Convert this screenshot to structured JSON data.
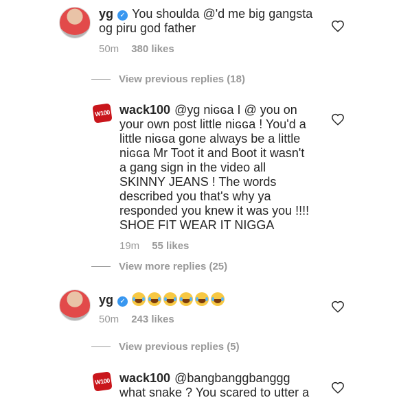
{
  "comments": [
    {
      "username": "yg",
      "text": "You shoulda @'d me big gangsta og piru god father",
      "time": "50m",
      "likes": "380 likes"
    },
    {
      "username": "wack100",
      "text": "@yg niɢɢa I @ you on your own post little niɢɢa ! You'd a little niɢɢa gone always be a little niɢɢa Mr Toot it and Boot it wasn't a gang sign in the video all SKINNY JEANS ! The words described you that's why ya responded you knew it was you !!!! SHOE FIT WEAR IT NIGGA",
      "time": "19m",
      "likes": "55 likes"
    },
    {
      "username": "yg",
      "emoji_count": 6,
      "time": "50m",
      "likes": "243 likes"
    },
    {
      "username": "wack100",
      "text": "@bangbanggbanggg what snake ? You scared to utter a name."
    }
  ],
  "replies_links": [
    {
      "label": "View previous replies (18)"
    },
    {
      "label": "View more replies (25)"
    },
    {
      "label": "View previous replies (5)"
    }
  ],
  "wack_logo_text": "W100",
  "icons": {
    "like": "heart-outline-icon",
    "verified": "verified-badge-icon"
  },
  "colors": {
    "text": "#262626",
    "muted": "#999999",
    "verified": "#3897f0"
  }
}
